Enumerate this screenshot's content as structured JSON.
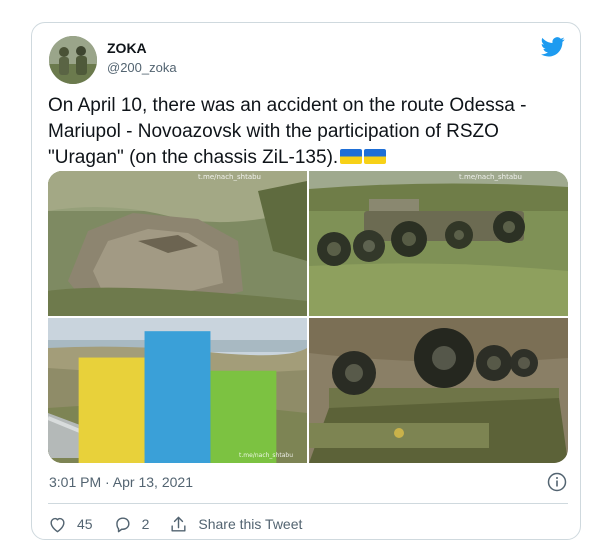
{
  "tweet": {
    "author": {
      "display_name": "ZOKA",
      "handle": "@200_zoka",
      "avatar_icon": "soldiers-photo"
    },
    "platform_icon": "twitter-bird-icon",
    "text": "On April 10, there was an accident on the route Odessa - Mariupol - Novoazovsk with the participation of RSZO \"Uragan\" (on the chassis ZiL-135).",
    "text_emoji": [
      "ukraine-flag",
      "ukraine-flag"
    ],
    "media": [
      {
        "subject": "tarp-covered-wreckage",
        "watermark": "t.me/nach_shtabu"
      },
      {
        "subject": "overturned-truck-wheels",
        "watermark": "t.me/nach_shtabu"
      },
      {
        "subject": "roadside-wreck-view",
        "watermark": "t.me/nach_shtabu"
      },
      {
        "subject": "overturned-launcher-closeup",
        "watermark": ""
      }
    ],
    "timestamp": "3:01 PM · Apr 13, 2021",
    "likes": "45",
    "replies": "2",
    "share_label": "Share this Tweet"
  },
  "colors": {
    "text_primary": "#0f1419",
    "text_secondary": "#536471",
    "twitter_blue": "#1d9bf0",
    "border": "#cfd9de"
  }
}
